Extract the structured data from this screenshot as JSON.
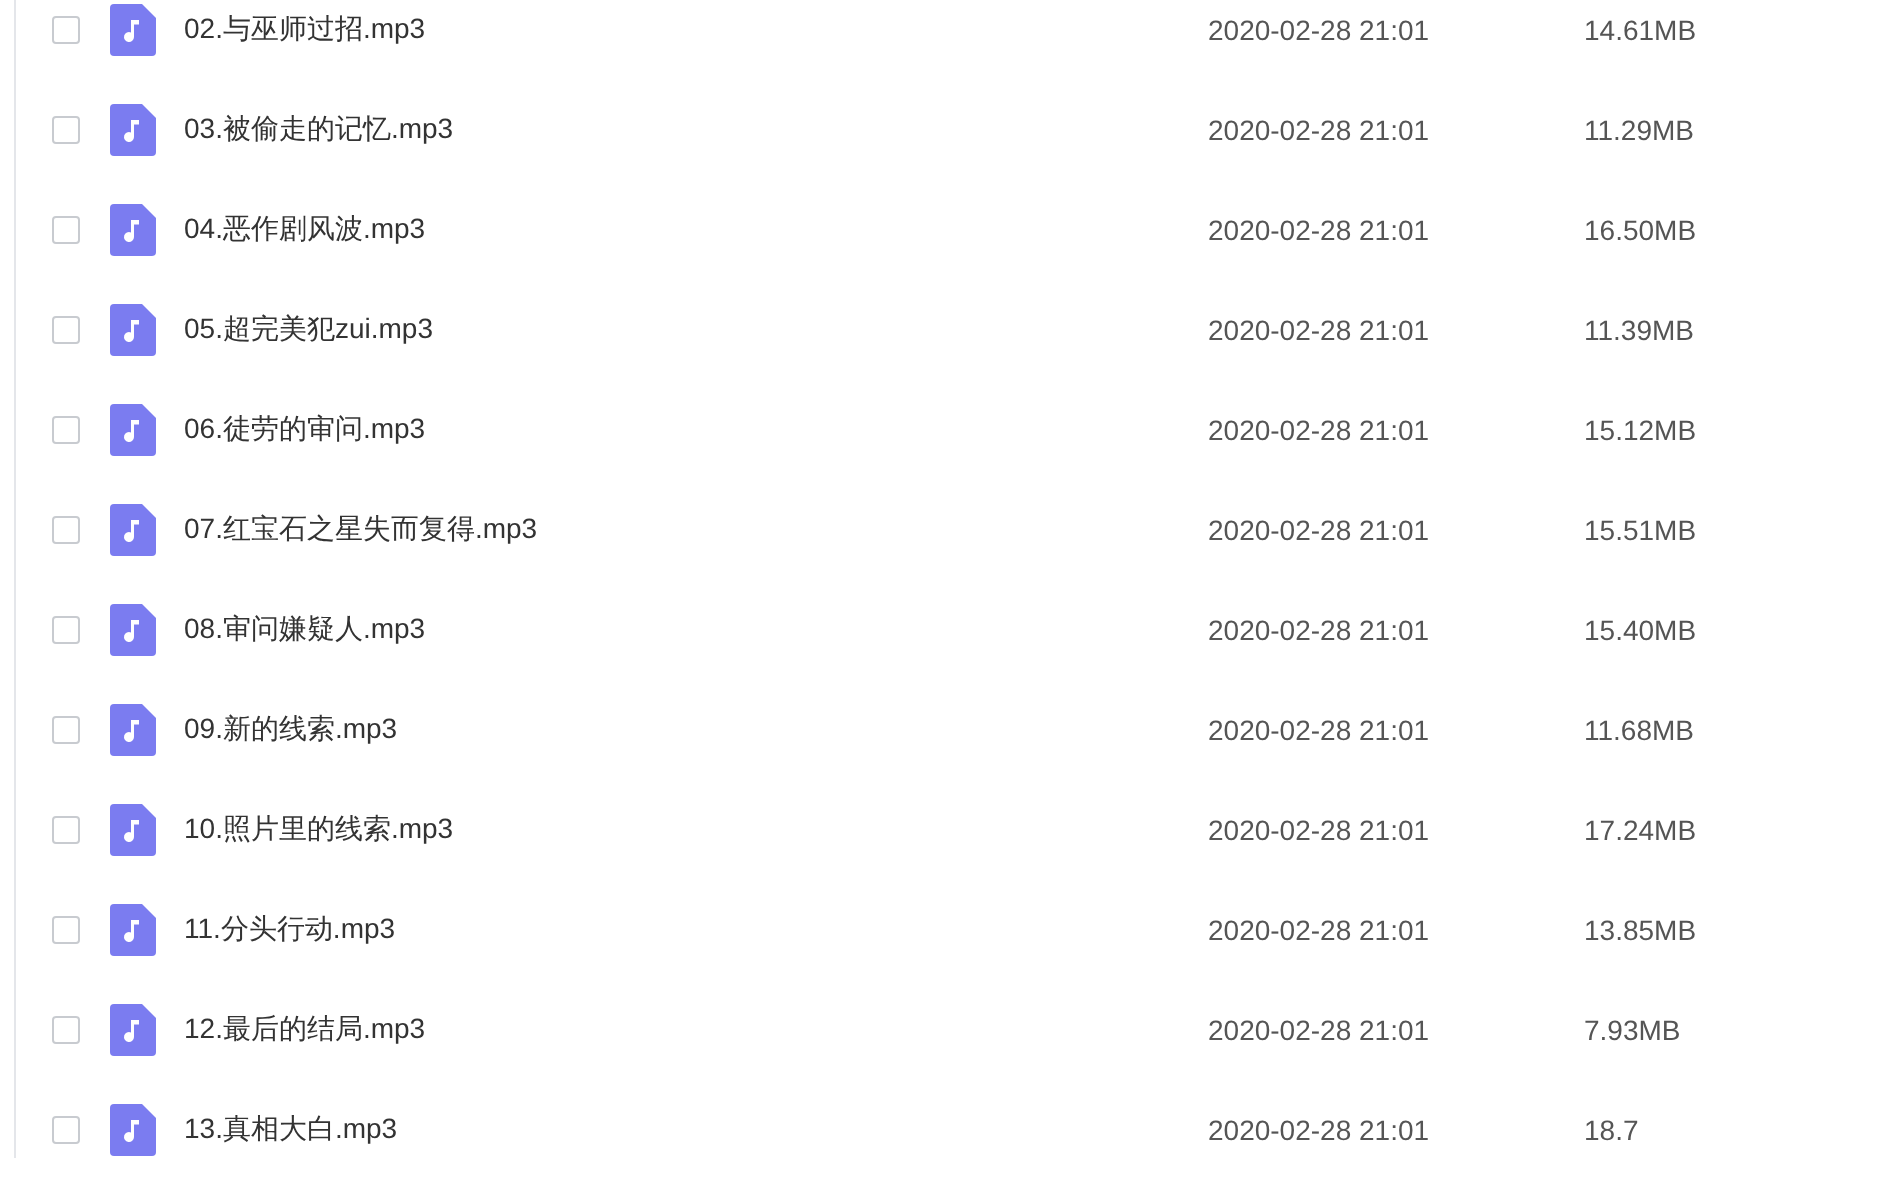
{
  "files": [
    {
      "name": "02.与巫师过招.mp3",
      "date": "2020-02-28 21:01",
      "size": "14.61MB",
      "checked": false
    },
    {
      "name": "03.被偷走的记忆.mp3",
      "date": "2020-02-28 21:01",
      "size": "11.29MB",
      "checked": false
    },
    {
      "name": "04.恶作剧风波.mp3",
      "date": "2020-02-28 21:01",
      "size": "16.50MB",
      "checked": false
    },
    {
      "name": "05.超完美犯zui.mp3",
      "date": "2020-02-28 21:01",
      "size": "11.39MB",
      "checked": false
    },
    {
      "name": "06.徒劳的审问.mp3",
      "date": "2020-02-28 21:01",
      "size": "15.12MB",
      "checked": false
    },
    {
      "name": "07.红宝石之星失而复得.mp3",
      "date": "2020-02-28 21:01",
      "size": "15.51MB",
      "checked": false
    },
    {
      "name": "08.审问嫌疑人.mp3",
      "date": "2020-02-28 21:01",
      "size": "15.40MB",
      "checked": false
    },
    {
      "name": "09.新的线索.mp3",
      "date": "2020-02-28 21:01",
      "size": "11.68MB",
      "checked": false
    },
    {
      "name": "10.照片里的线索.mp3",
      "date": "2020-02-28 21:01",
      "size": "17.24MB",
      "checked": false
    },
    {
      "name": "11.分头行动.mp3",
      "date": "2020-02-28 21:01",
      "size": "13.85MB",
      "checked": false
    },
    {
      "name": "12.最后的结局.mp3",
      "date": "2020-02-28 21:01",
      "size": "7.93MB",
      "checked": false
    },
    {
      "name": "13.真相大白.mp3",
      "date": "2020-02-28 21:01",
      "size": "18.7",
      "checked": false
    }
  ]
}
